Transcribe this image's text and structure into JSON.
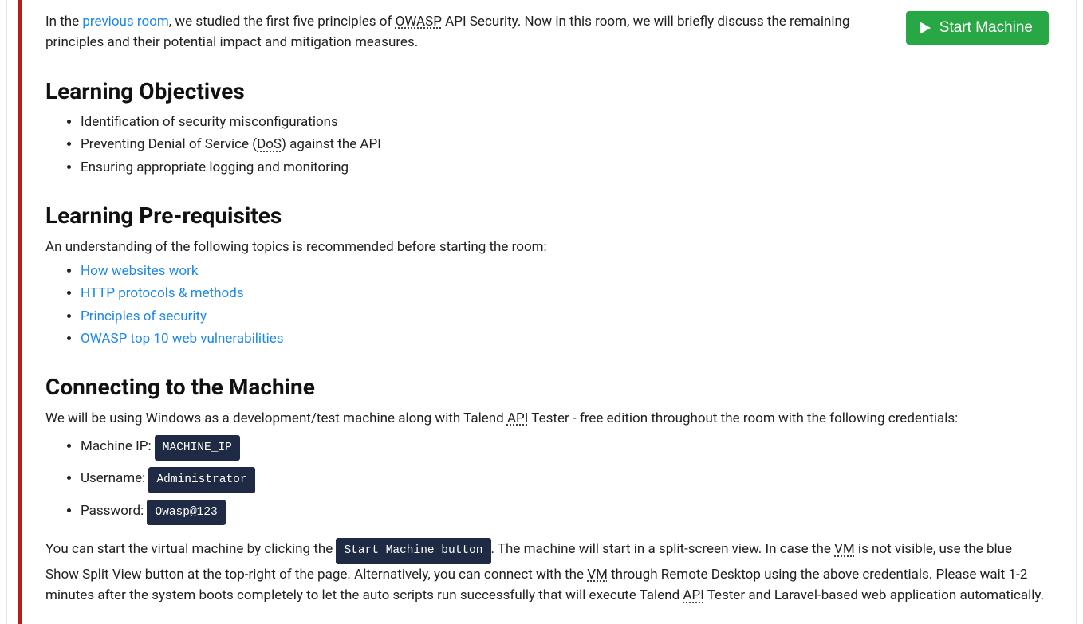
{
  "startButton": {
    "label": "Start Machine"
  },
  "intro": {
    "pre": "In the ",
    "link": "previous room",
    "mid1": ", we studied the first five principles of ",
    "abbr1": "OWASP",
    "mid2": " API Security. Now in this room, we will briefly discuss the remaining principles and their potential impact and mitigation measures."
  },
  "sections": {
    "objectives": {
      "heading": "Learning Objectives",
      "items": {
        "0": "Identification of security misconfigurations",
        "1_pre": "Preventing Denial of Service (",
        "1_abbr": "DoS",
        "1_post": ") against the API",
        "2": "Ensuring appropriate logging and monitoring"
      }
    },
    "prereq": {
      "heading": "Learning Pre-requisites",
      "lead": "An understanding of the following topics is recommended before starting the room:",
      "links": {
        "0": "How websites work",
        "1": "HTTP protocols & methods",
        "2": "Principles of security",
        "3": "OWASP top 10 web vulnerabilities"
      }
    },
    "connect": {
      "heading": "Connecting to the Machine",
      "lead_pre": "We will be using Windows as a development/test machine along with Talend ",
      "lead_abbr": "API",
      "lead_post": " Tester - free edition throughout the room with the following credentials:",
      "creds": {
        "ip_label": "Machine IP: ",
        "ip_value": "MACHINE_IP",
        "user_label": "Username: ",
        "user_value": "Administrator",
        "pass_label": "Password: ",
        "pass_value": "Owasp@123"
      },
      "final": {
        "p1": "You can start the virtual machine by clicking the ",
        "pill": "Start Machine button",
        "p2": ". The machine will start in a split-screen view. In case the ",
        "abbr_vm1": "VM",
        "p3": " is not visible, use the blue Show Split View button at the top-right of the page. Alternatively, you can connect with the ",
        "abbr_vm2": "VM",
        "p4": " through Remote Desktop using the above credentials. Please wait 1-2 minutes after the system boots completely to let the auto scripts run successfully that will execute Talend ",
        "abbr_api": "API",
        "p5": " Tester and Laravel-based web application automatically."
      }
    }
  }
}
